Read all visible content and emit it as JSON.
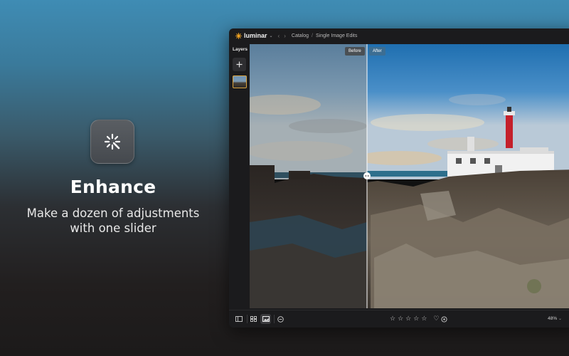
{
  "promo": {
    "title": "Enhance",
    "subtitle_line1": "Make a dozen of adjustments",
    "subtitle_line2": "with one slider",
    "icon": "sparkle-enhance-icon"
  },
  "app": {
    "brand": "luminar",
    "breadcrumb": [
      "Catalog",
      "Single Image Edits"
    ],
    "sidebar": {
      "layers_label": "Layers"
    },
    "compare": {
      "before_label": "Before",
      "after_label": "After",
      "split_position": 0.36
    },
    "toolbar": {
      "zoom_label": "48%",
      "rating_stars": 5,
      "rating_value": 0
    },
    "colors": {
      "accent": "#3c6e93",
      "thumb_border": "#d9a441",
      "logo": "#f5a623"
    }
  }
}
